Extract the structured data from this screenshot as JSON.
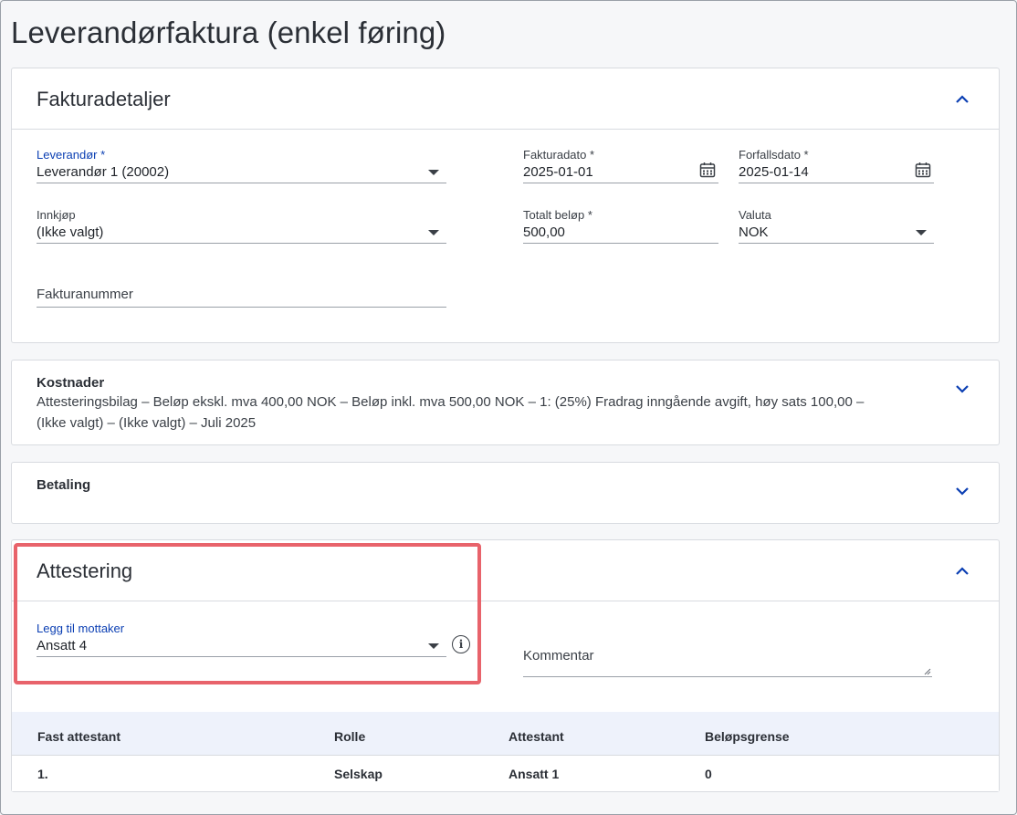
{
  "page": {
    "title": "Leverandørfaktura (enkel føring)"
  },
  "fakturadetaljer": {
    "heading": "Fakturadetaljer",
    "leverandor": {
      "label": "Leverandør *",
      "value": "Leverandør 1 (20002)"
    },
    "fakturadato": {
      "label": "Fakturadato *",
      "value": "2025-01-01"
    },
    "forfallsdato": {
      "label": "Forfallsdato *",
      "value": "2025-01-14"
    },
    "innkjop": {
      "label": "Innkjøp",
      "value": "(Ikke valgt)"
    },
    "totalt_belop": {
      "label": "Totalt beløp *",
      "value": "500,00"
    },
    "valuta": {
      "label": "Valuta",
      "value": "NOK"
    },
    "fakturanummer": {
      "placeholder": "Fakturanummer"
    }
  },
  "kostnader": {
    "heading": "Kostnader",
    "summary_line1": "Attesteringsbilag  –  Beløp ekskl. mva 400,00 NOK  –  Beløp inkl. mva 500,00 NOK  –  1: (25%) Fradrag inngående avgift, høy sats 100,00  –",
    "summary_line2": "(Ikke valgt)  –  (Ikke valgt)  –  Juli 2025"
  },
  "betaling": {
    "heading": "Betaling"
  },
  "attestering": {
    "heading": "Attestering",
    "mottaker": {
      "label": "Legg til mottaker",
      "value": "Ansatt 4"
    },
    "kommentar": {
      "placeholder": "Kommentar"
    },
    "table": {
      "columns": [
        "Fast attestant",
        "Rolle",
        "Attestant",
        "Beløpsgrense"
      ],
      "rows": [
        {
          "nr": "1.",
          "rolle": "Selskap",
          "attestant": "Ansatt 1",
          "grense": "0"
        }
      ]
    }
  },
  "colors": {
    "accent": "#0b3fb3",
    "highlight": "#e8636b",
    "table_header": "#eef2fb"
  },
  "icons": [
    "chevron-up-icon",
    "chevron-down-icon",
    "calendar-icon",
    "info-icon",
    "caret-down-icon"
  ]
}
